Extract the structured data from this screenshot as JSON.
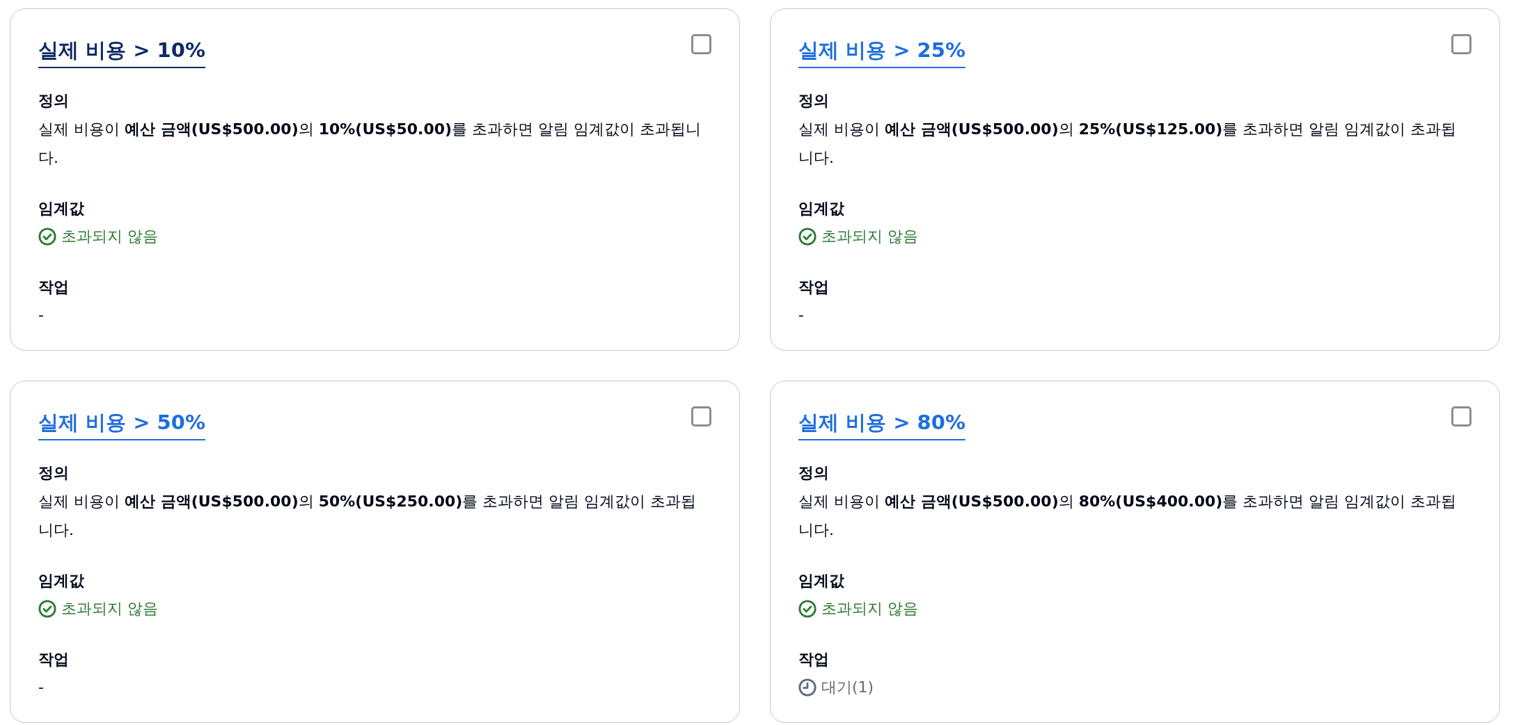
{
  "cards": [
    {
      "title": "실제 비용 > 10%",
      "visited": true,
      "checked": false,
      "definition_label": "정의",
      "definition": "실제 비용이 **예산 금액(US$500.00)**의 **10%(US$50.00)**를 초과하면 알림 임계값이 초과됩니다.",
      "threshold_label": "임계값",
      "threshold": {
        "kind": "ok",
        "text": "초과되지 않음"
      },
      "action_label": "작업",
      "action": {
        "kind": "plain",
        "text": "-"
      }
    },
    {
      "title": "실제 비용 > 25%",
      "visited": false,
      "checked": false,
      "definition_label": "정의",
      "definition": "실제 비용이 **예산 금액(US$500.00)**의 **25%(US$125.00)**를 초과하면 알림 임계값이 초과됩니다.",
      "threshold_label": "임계값",
      "threshold": {
        "kind": "ok",
        "text": "초과되지 않음"
      },
      "action_label": "작업",
      "action": {
        "kind": "plain",
        "text": "-"
      }
    },
    {
      "title": "실제 비용 > 50%",
      "visited": false,
      "checked": false,
      "definition_label": "정의",
      "definition": "실제 비용이 **예산 금액(US$500.00)**의 **50%(US$250.00)**를 초과하면 알림 임계값이 초과됩니다.",
      "threshold_label": "임계값",
      "threshold": {
        "kind": "ok",
        "text": "초과되지 않음"
      },
      "action_label": "작업",
      "action": {
        "kind": "plain",
        "text": "-"
      }
    },
    {
      "title": "실제 비용 > 80%",
      "visited": false,
      "checked": false,
      "definition_label": "정의",
      "definition": "실제 비용이 **예산 금액(US$500.00)**의 **80%(US$400.00)**를 초과하면 알림 임계값이 초과됩니다.",
      "threshold_label": "임계값",
      "threshold": {
        "kind": "ok",
        "text": "초과되지 않음"
      },
      "action_label": "작업",
      "action": {
        "kind": "pending",
        "text": "대기(1)"
      }
    }
  ]
}
